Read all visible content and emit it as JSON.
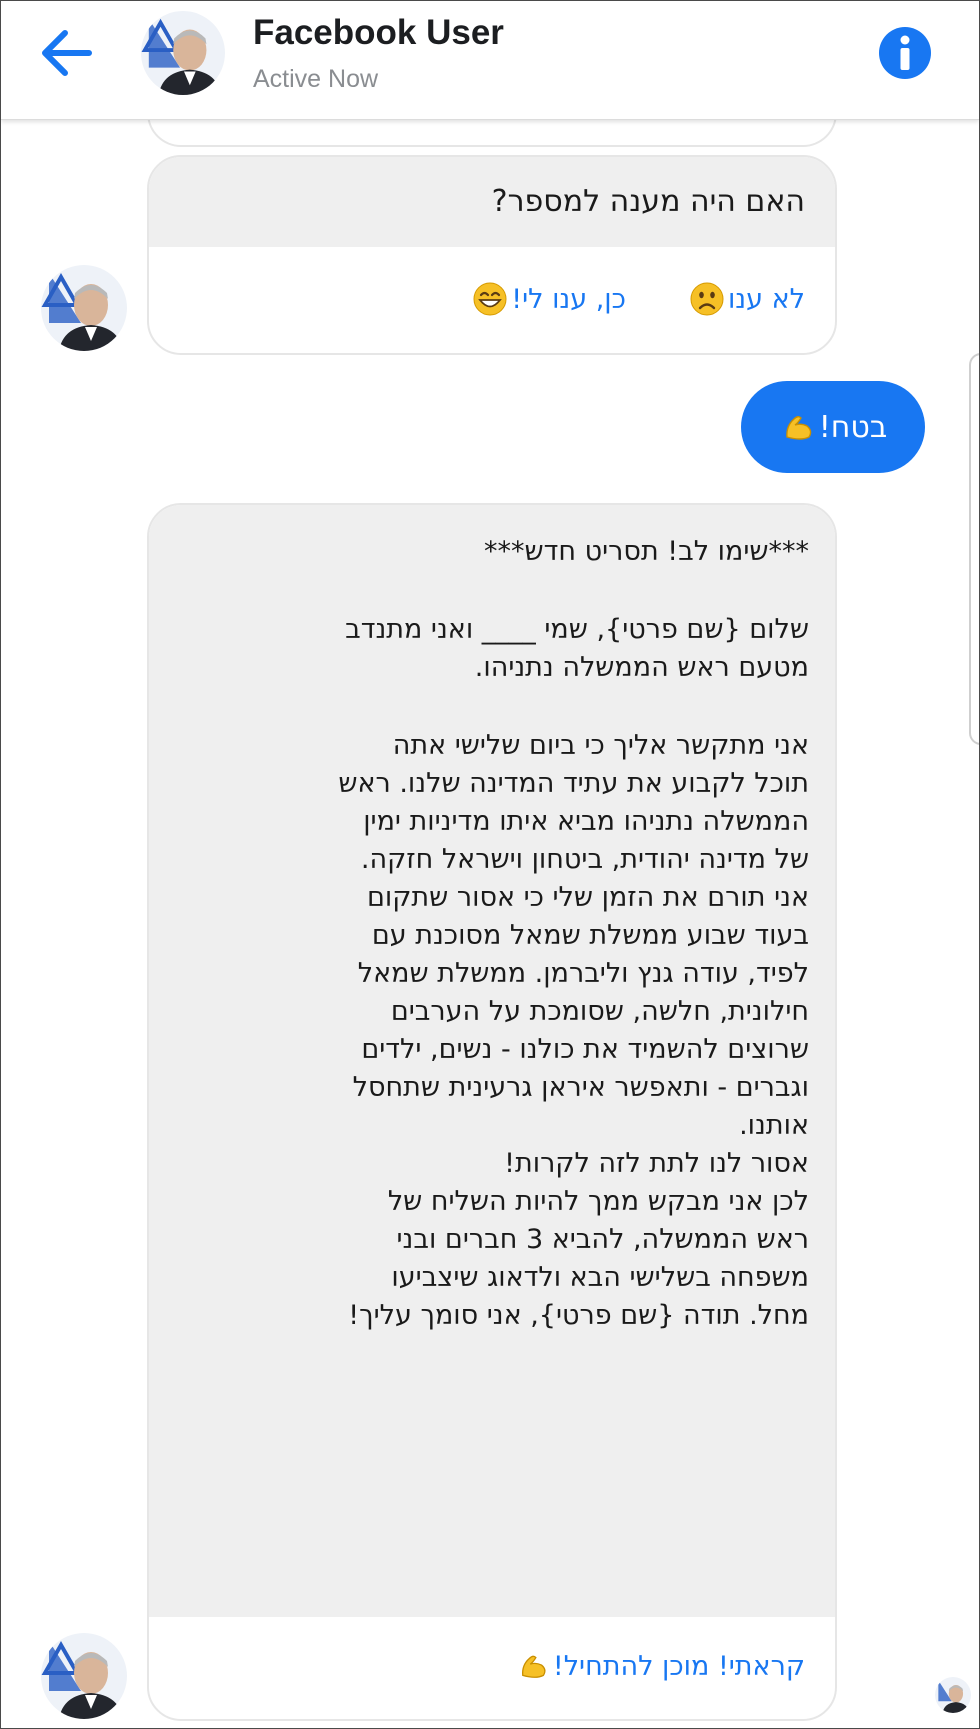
{
  "header": {
    "name": "Facebook User",
    "status": "Active Now",
    "back_icon": "back-arrow-icon",
    "info_icon": "info-icon",
    "accent": "#1877f2"
  },
  "messages": {
    "question": {
      "text": "האם היה מענה למספר?",
      "reply_no": "לא ענו",
      "reply_no_emoji": "worried-face-emoji",
      "reply_yes": "כן, ענו לי!",
      "reply_yes_emoji": "grinning-face-emoji"
    },
    "sent": {
      "text": "בטח!",
      "emoji": "flexed-biceps-emoji"
    },
    "script": {
      "title": "***שימו לב! תסריט חדש***",
      "intro_lines": [
        "שלום {שם פרטי}, שמי ____ ואני מתנדב",
        "מטעם ראש הממשלה נתניהו."
      ],
      "body_lines": [
        "אני מתקשר אליך כי ביום שלישי אתה",
        "תוכל לקבוע את עתיד המדינה שלנו. ראש",
        "הממשלה נתניהו מביא איתו מדיניות ימין",
        "של מדינה יהודית, ביטחון וישראל חזקה.",
        "אני תורם את הזמן שלי כי אסור שתקום",
        "בעוד שבוע ממשלת שמאל מסוכנת עם",
        "לפיד, עודה גנץ וליברמן. ממשלת שמאל",
        "חילונית, חלשה, שסומכת על הערבים",
        "שרוצים להשמיד את כולנו - נשים, ילדים",
        "וגברים - ותאפשר איראן גרעינית שתחסל",
        "אותנו.",
        "אסור לנו לתת לזה לקרות!",
        "לכן אני מבקש ממך להיות השליח של",
        "ראש הממשלה, להביא 3 חברים ובני",
        "משפחה בשלישי הבא ולדאוג שיצביעו",
        "מחל. תודה {שם פרטי}, אני סומך עליך!"
      ],
      "reply_ready": "קראתי! מוכן להתחיל!",
      "reply_ready_emoji": "flexed-biceps-emoji"
    }
  },
  "avatar": {
    "icon": "profile-photo",
    "flag_color": "#1e5bc6"
  }
}
